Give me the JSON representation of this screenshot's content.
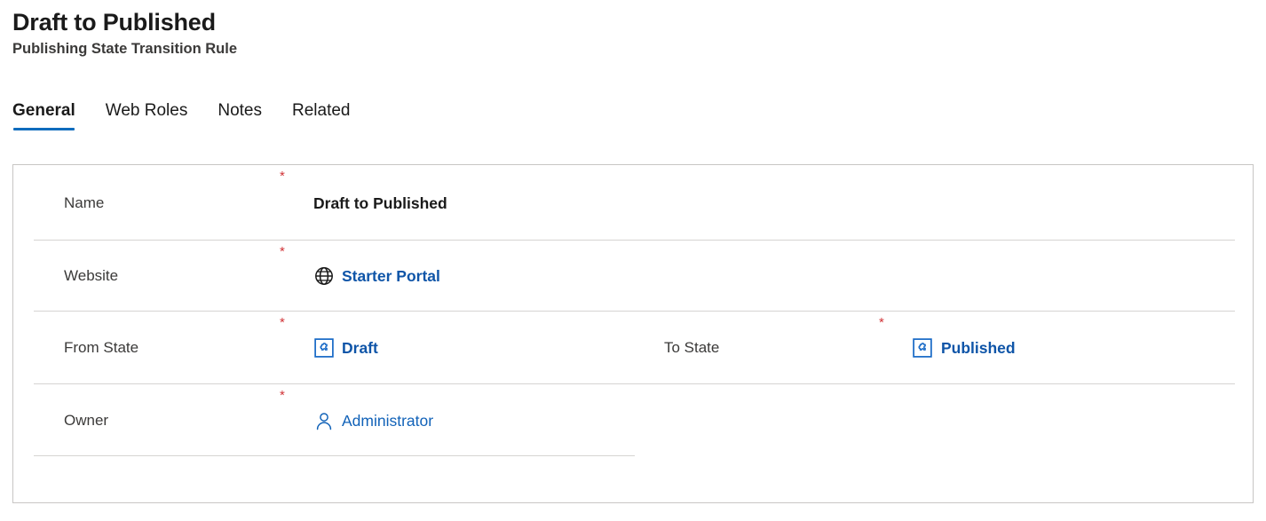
{
  "header": {
    "title": "Draft to Published",
    "subtitle": "Publishing State Transition Rule"
  },
  "tabs": [
    {
      "label": "General",
      "active": true
    },
    {
      "label": "Web Roles",
      "active": false
    },
    {
      "label": "Notes",
      "active": false
    },
    {
      "label": "Related",
      "active": false
    }
  ],
  "form": {
    "required_marker": "*",
    "rows": {
      "name": {
        "label": "Name",
        "required": true,
        "value": "Draft to Published",
        "icon": null
      },
      "website": {
        "label": "Website",
        "required": true,
        "value": "Starter Portal",
        "icon": "globe-icon"
      },
      "from_state": {
        "label": "From State",
        "required": true,
        "value": "Draft",
        "icon": "puzzle-entity-icon"
      },
      "to_state": {
        "label": "To State",
        "required": true,
        "value": "Published",
        "icon": "puzzle-entity-icon"
      },
      "owner": {
        "label": "Owner",
        "required": true,
        "value": "Administrator",
        "icon": "person-icon"
      }
    }
  },
  "colors": {
    "accent": "#0f6cbd",
    "link": "#0f55a8",
    "link_regular": "#1162b8",
    "required": "#d13438",
    "label": "#3b3a39",
    "text": "#1a1a1a",
    "border": "#c8c6c4",
    "divider": "#d6d4d2"
  }
}
